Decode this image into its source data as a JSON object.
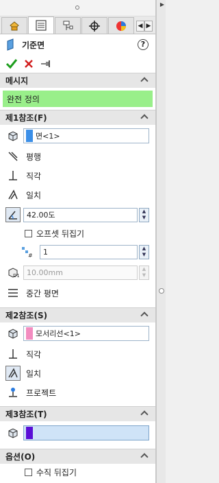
{
  "feature": {
    "title": "기준면"
  },
  "message_section": {
    "header": "메시지",
    "text": "완전 정의"
  },
  "ref1": {
    "header": "제1참조(F)",
    "selection": "면<1>",
    "selection_color": "#3b8fe8",
    "options": [
      "평행",
      "직각",
      "일치"
    ],
    "angle_value": "42.00도",
    "flip_offset_label": "오프셋 뒤집기",
    "count_value": "1",
    "distance_value": "10.00mm",
    "midplane_label": "중간 평면"
  },
  "ref2": {
    "header": "제2참조(S)",
    "selection": "모서리선<1>",
    "selection_color": "#f38cc0",
    "options": [
      "직각",
      "일치",
      "프로젝트"
    ]
  },
  "ref3": {
    "header": "제3참조(T)",
    "selection": "",
    "selection_color": "#5a0fd6"
  },
  "options_section": {
    "header": "옵션(O)",
    "flip_normal_label": "수직 뒤집기"
  },
  "colors": {
    "message_bg": "#99ef8a",
    "accept": "#1e9e1e",
    "cancel": "#d21f1f"
  }
}
